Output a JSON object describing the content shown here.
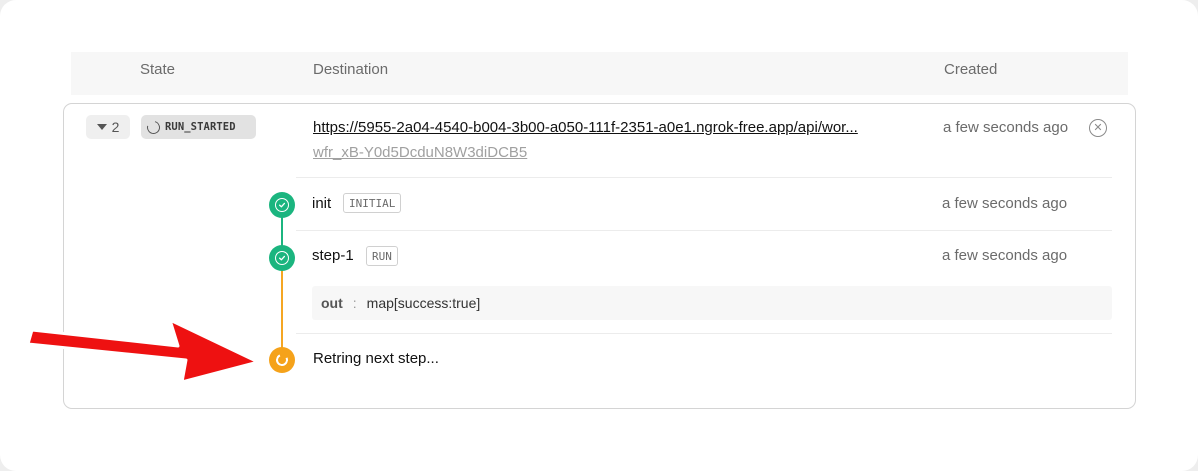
{
  "table": {
    "columns": {
      "state": "State",
      "destination": "Destination",
      "created": "Created"
    }
  },
  "run": {
    "count": "2",
    "state": "RUN_STARTED",
    "url": "https://5955-2a04-4540-b004-3b00-a050-111f-2351-a0e1.ngrok-free.app/api/wor...",
    "id": "wfr_xB-Y0d5DcduN8W3diDCB5",
    "created": "a few seconds ago"
  },
  "steps": [
    {
      "name": "init",
      "tag": "INITIAL",
      "created": "a few seconds ago",
      "status": "success"
    },
    {
      "name": "step-1",
      "tag": "RUN",
      "created": "a few seconds ago",
      "status": "success",
      "output": {
        "key": "out",
        "separator": ":",
        "value": "map[success:true]"
      }
    }
  ],
  "pending": {
    "text": "Retring next step...",
    "status": "in-progress"
  },
  "colors": {
    "success": "#1bb57f",
    "pending": "#f5a21a",
    "arrow": "#ee1111"
  },
  "icons": {
    "expand": "caret-down-icon",
    "state": "spinner-icon",
    "cancel": "close-circle-icon",
    "success": "check-circle-icon",
    "pending": "spinner-icon",
    "annotation": "red-arrow"
  }
}
